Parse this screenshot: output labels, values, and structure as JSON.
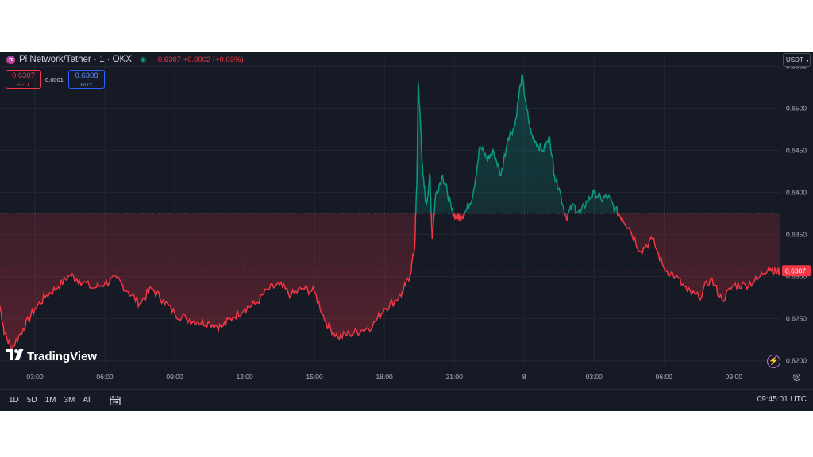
{
  "header": {
    "symbol": "Pi Network/Tether · 1 · OKX",
    "price_change": "0.6307 +0.0002 (+0.03%)",
    "logo_icon": "pi-network-logo-icon",
    "status_icon": "market-open-dot-icon"
  },
  "trade": {
    "sell_price": "0.6307",
    "sell_label": "SELL",
    "spread": "0.0001",
    "buy_price": "0.6308",
    "buy_label": "BUY"
  },
  "currency_selector": {
    "value": "USDT",
    "icon": "chevron-down-icon"
  },
  "branding": {
    "logo_mark": "17",
    "name": "TradingView"
  },
  "bottom_bar": {
    "ranges": [
      "1D",
      "5D",
      "1M",
      "3M",
      "All"
    ],
    "calendar_icon": "calendar-range-icon",
    "clock": "09:45:01 UTC",
    "settings_icon": "gear-icon"
  },
  "colors": {
    "background": "#161a25",
    "up": "#089981",
    "down": "#f23645",
    "axis_text": "#b2b5be"
  },
  "chart_data": {
    "type": "area",
    "title": "",
    "xlabel": "",
    "ylabel": "",
    "x_ticks": [
      "03:00",
      "06:00",
      "09:00",
      "12:00",
      "15:00",
      "18:00",
      "21:00",
      "8",
      "03:00",
      "06:00",
      "09:00"
    ],
    "y_ticks": [
      "0.6200",
      "0.6250",
      "0.6300",
      "0.6350",
      "0.6400",
      "0.6450",
      "0.6500",
      "0.6550"
    ],
    "ylim": [
      0.6195,
      0.656
    ],
    "xlim": [
      0,
      33.5
    ],
    "baseline": 0.6375,
    "last_price": 0.6307,
    "last_price_label": "0.6307",
    "grid": true,
    "series": [
      {
        "x": [
          0,
          0.2,
          0.5,
          1,
          1.5,
          2,
          2.5,
          3,
          3.4,
          4,
          4.5,
          5,
          5.5,
          6,
          6.5,
          7,
          7.5,
          8,
          8.5,
          9,
          9.5,
          10,
          10.5,
          11,
          11.5,
          12,
          12.5,
          13,
          13.5,
          14,
          14.5,
          15,
          15.5,
          16,
          16.5,
          17,
          17.3,
          17.6,
          17.8,
          17.9,
          17.95,
          18.05,
          18.15,
          18.3,
          18.45,
          18.55,
          18.7,
          19,
          19.2,
          19.4,
          19.6,
          19.8,
          20,
          20.3,
          20.6,
          20.9,
          21.2,
          21.5,
          21.8,
          22.1,
          22.4,
          22.6,
          22.8,
          23,
          23.3,
          23.6,
          23.8,
          24,
          24.3,
          24.6,
          24.9,
          25.2,
          25.5,
          25.8,
          26.1,
          26.4,
          26.7,
          27,
          27.5,
          28,
          28.5,
          29,
          29.5,
          30,
          30.5,
          31,
          31.5,
          32,
          32.5,
          33,
          33.3,
          33.5
        ],
        "y": [
          0.6265,
          0.6232,
          0.6215,
          0.6238,
          0.6262,
          0.6278,
          0.6288,
          0.6302,
          0.6296,
          0.6286,
          0.6292,
          0.6298,
          0.6282,
          0.6268,
          0.6286,
          0.6272,
          0.6256,
          0.625,
          0.6246,
          0.6245,
          0.624,
          0.6252,
          0.6262,
          0.6268,
          0.6285,
          0.629,
          0.6278,
          0.6286,
          0.6282,
          0.6245,
          0.6228,
          0.6232,
          0.6236,
          0.6242,
          0.6262,
          0.6272,
          0.6282,
          0.6302,
          0.6335,
          0.642,
          0.6532,
          0.648,
          0.642,
          0.6385,
          0.642,
          0.6345,
          0.6398,
          0.642,
          0.64,
          0.6378,
          0.637,
          0.6372,
          0.6378,
          0.6398,
          0.6455,
          0.644,
          0.6448,
          0.642,
          0.6465,
          0.648,
          0.654,
          0.65,
          0.647,
          0.646,
          0.645,
          0.6465,
          0.642,
          0.6405,
          0.637,
          0.6385,
          0.6375,
          0.639,
          0.64,
          0.6392,
          0.6395,
          0.638,
          0.637,
          0.6358,
          0.633,
          0.6345,
          0.631,
          0.63,
          0.6283,
          0.6275,
          0.6298,
          0.6272,
          0.629,
          0.629,
          0.6296,
          0.6312,
          0.6305,
          0.6307
        ]
      }
    ]
  }
}
